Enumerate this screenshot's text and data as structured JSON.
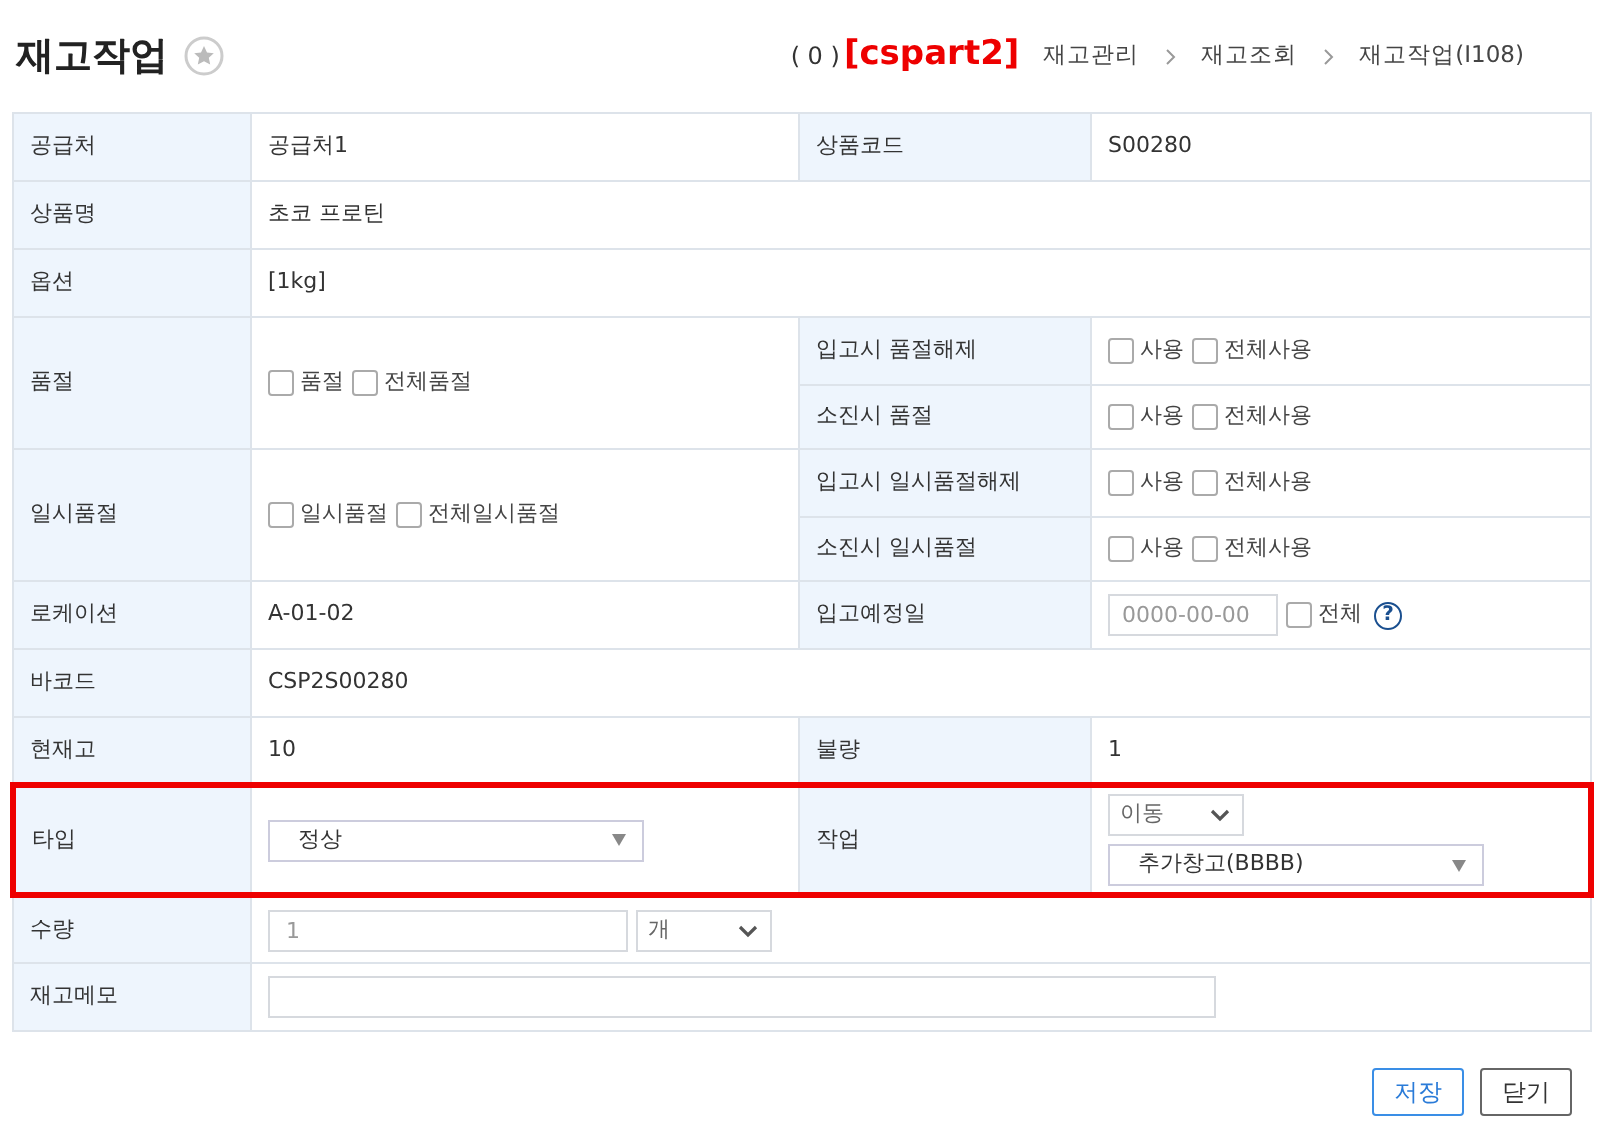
{
  "header": {
    "title": "재고작업",
    "count": "( 0 )",
    "site": "[cspart2]",
    "breadcrumbs": [
      "재고관리",
      "재고조회",
      "재고작업(I108)"
    ]
  },
  "rows": [
    {
      "label": "공급처",
      "fields": [
        {
          "kind": "text",
          "text": "공급처1"
        }
      ],
      "right": [
        {
          "label": "상품코드",
          "fields": [
            {
              "kind": "text",
              "text": "S00280"
            }
          ]
        }
      ]
    },
    {
      "label": "상품명",
      "fields": [
        {
          "kind": "text",
          "text": "초코 프로틴"
        }
      ]
    },
    {
      "label": "옵션",
      "fields": [
        {
          "kind": "text",
          "text": "[1kg]"
        }
      ]
    },
    {
      "label": "품절",
      "fields": [
        {
          "kind": "checkbox",
          "label": "품절",
          "checked": false
        },
        {
          "kind": "checkbox",
          "label": "전체품절",
          "checked": false
        }
      ],
      "right": [
        {
          "label": "입고시 품절해제",
          "fields": [
            {
              "kind": "checkbox",
              "label": "사용",
              "checked": false
            },
            {
              "kind": "checkbox",
              "label": "전체사용",
              "checked": false
            }
          ]
        },
        {
          "label": "소진시 품절",
          "fields": [
            {
              "kind": "checkbox",
              "label": "사용",
              "checked": false
            },
            {
              "kind": "checkbox",
              "label": "전체사용",
              "checked": false
            }
          ]
        }
      ]
    },
    {
      "label": "일시품절",
      "fields": [
        {
          "kind": "checkbox",
          "label": "일시품절",
          "checked": false
        },
        {
          "kind": "checkbox",
          "label": "전체일시품절",
          "checked": false
        }
      ],
      "right": [
        {
          "label": "입고시 일시품절해제",
          "fields": [
            {
              "kind": "checkbox",
              "label": "사용",
              "checked": false
            },
            {
              "kind": "checkbox",
              "label": "전체사용",
              "checked": false
            }
          ]
        },
        {
          "label": "소진시 일시품절",
          "fields": [
            {
              "kind": "checkbox",
              "label": "사용",
              "checked": false
            },
            {
              "kind": "checkbox",
              "label": "전체사용",
              "checked": false
            }
          ]
        }
      ]
    },
    {
      "label": "로케이션",
      "fields": [
        {
          "kind": "text",
          "text": "A-01-02"
        }
      ],
      "right": [
        {
          "label": "입고예정일",
          "fields": [
            {
              "kind": "date",
              "placeholder": "0000-00-00"
            },
            {
              "kind": "checkbox",
              "label": "전체",
              "checked": false
            },
            {
              "kind": "help",
              "text": "?"
            }
          ]
        }
      ]
    },
    {
      "label": "바코드",
      "fields": [
        {
          "kind": "text",
          "text": "CSP2S00280"
        }
      ]
    },
    {
      "label": "현재고",
      "fields": [
        {
          "kind": "text",
          "text": "10"
        }
      ],
      "right": [
        {
          "label": "불량",
          "fields": [
            {
              "kind": "text",
              "text": "1"
            }
          ]
        }
      ]
    },
    {
      "label": "타입",
      "highlighted": true,
      "fields": [
        {
          "kind": "select",
          "value": "정상"
        }
      ],
      "right": [
        {
          "label": "작업",
          "stacked": true,
          "fields": [
            {
              "kind": "combo",
              "value": "이동"
            },
            {
              "kind": "select",
              "value": "추가창고(BBBB)"
            }
          ]
        }
      ]
    },
    {
      "label": "수량",
      "fields": [
        {
          "kind": "input",
          "placeholder": "1"
        },
        {
          "kind": "combo",
          "value": "개"
        }
      ]
    },
    {
      "label": "재고메모",
      "fields": [
        {
          "kind": "memo"
        }
      ]
    }
  ],
  "buttons": [
    {
      "label": "저장",
      "kind": "primary"
    },
    {
      "label": "닫기",
      "kind": "default"
    }
  ]
}
